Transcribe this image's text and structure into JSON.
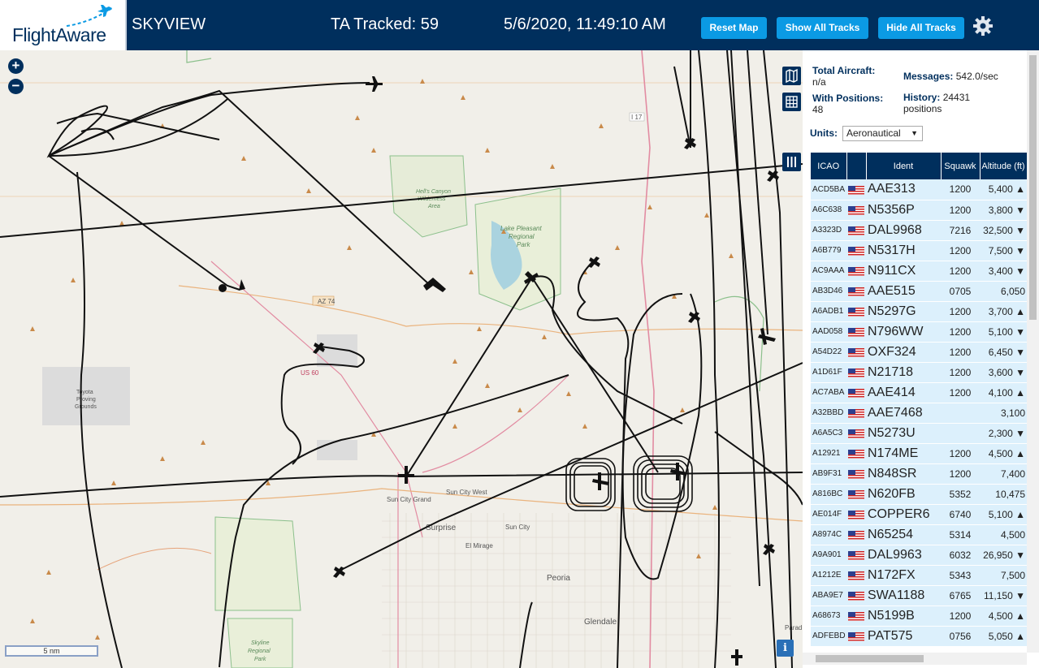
{
  "header": {
    "logo": "FlightAware",
    "title": "SKYVIEW",
    "tracked": "TA Tracked: 59",
    "clock": "5/6/2020, 11:49:10 AM",
    "buttons": {
      "reset": "Reset Map",
      "show": "Show All Tracks",
      "hide": "Hide All Tracks"
    }
  },
  "map": {
    "zoom_in": "+",
    "zoom_out": "−",
    "scale": "5 nm",
    "info": "i",
    "labels": {
      "az74": "AZ 74",
      "lake": "Lake Pleasant",
      "lake2": "Regional",
      "lake3": "Park",
      "hells1": "Hell's Canyon",
      "hells2": "Wilderness",
      "hells3": "Area",
      "toyota1": "Toyota",
      "toyota2": "Proving",
      "toyota3": "Grounds",
      "suncitygrand": "Sun City Grand",
      "suncitywest": "Sun City West",
      "surprise": "Surprise",
      "elmirage": "El Mirage",
      "suncity": "Sun City",
      "peoria": "Peoria",
      "glendale": "Glendale",
      "skyline1": "Skyline",
      "skyline2": "Regional",
      "skyline3": "Park",
      "i17": "I 17",
      "us60": "US 60",
      "parad": "Parad"
    }
  },
  "stats": {
    "total_label": "Total Aircraft:",
    "total_value": "n/a",
    "positions_label": "With Positions:",
    "positions_value": "48",
    "messages_label": "Messages:",
    "messages_value": "542.0/sec",
    "history_label": "History:",
    "history_value": "24431",
    "history_unit": "positions"
  },
  "units": {
    "label": "Units:",
    "selected": "Aeronautical"
  },
  "table": {
    "headers": [
      "ICAO",
      "",
      "Ident",
      "Squawk",
      "Altitude (ft)"
    ],
    "rows": [
      {
        "icao": "ACD5BA",
        "ident": "AAE313",
        "squawk": "1200",
        "alt": "5,400 ▲"
      },
      {
        "icao": "A6C638",
        "ident": "N5356P",
        "squawk": "1200",
        "alt": "3,800 ▼"
      },
      {
        "icao": "A3323D",
        "ident": "DAL9968",
        "squawk": "7216",
        "alt": "32,500 ▼"
      },
      {
        "icao": "A6B779",
        "ident": "N5317H",
        "squawk": "1200",
        "alt": "7,500 ▼"
      },
      {
        "icao": "AC9AAA",
        "ident": "N911CX",
        "squawk": "1200",
        "alt": "3,400 ▼"
      },
      {
        "icao": "AB3D46",
        "ident": "AAE515",
        "squawk": "0705",
        "alt": "6,050"
      },
      {
        "icao": "A6ADB1",
        "ident": "N5297G",
        "squawk": "1200",
        "alt": "3,700 ▲"
      },
      {
        "icao": "AAD058",
        "ident": "N796WW",
        "squawk": "1200",
        "alt": "5,100 ▼"
      },
      {
        "icao": "A54D22",
        "ident": "OXF324",
        "squawk": "1200",
        "alt": "6,450 ▼"
      },
      {
        "icao": "A1D61F",
        "ident": "N21718",
        "squawk": "1200",
        "alt": "3,600 ▼"
      },
      {
        "icao": "AC7ABA",
        "ident": "AAE414",
        "squawk": "1200",
        "alt": "4,100 ▲"
      },
      {
        "icao": "A32BBD",
        "ident": "AAE7468",
        "squawk": "",
        "alt": "3,100"
      },
      {
        "icao": "A6A5C3",
        "ident": "N5273U",
        "squawk": "",
        "alt": "2,300 ▼"
      },
      {
        "icao": "A12921",
        "ident": "N174ME",
        "squawk": "1200",
        "alt": "4,500 ▲"
      },
      {
        "icao": "AB9F31",
        "ident": "N848SR",
        "squawk": "1200",
        "alt": "7,400"
      },
      {
        "icao": "A816BC",
        "ident": "N620FB",
        "squawk": "5352",
        "alt": "10,475"
      },
      {
        "icao": "AE014F",
        "ident": "COPPER6",
        "squawk": "6740",
        "alt": "5,100 ▲"
      },
      {
        "icao": "A8974C",
        "ident": "N65254",
        "squawk": "5314",
        "alt": "4,500"
      },
      {
        "icao": "A9A901",
        "ident": "DAL9963",
        "squawk": "6032",
        "alt": "26,950 ▼"
      },
      {
        "icao": "A1212E",
        "ident": "N172FX",
        "squawk": "5343",
        "alt": "7,500"
      },
      {
        "icao": "ABA9E7",
        "ident": "SWA1188",
        "squawk": "6765",
        "alt": "11,150 ▼"
      },
      {
        "icao": "A68673",
        "ident": "N5199B",
        "squawk": "1200",
        "alt": "4,500 ▲"
      },
      {
        "icao": "ADFEBD",
        "ident": "PAT575",
        "squawk": "0756",
        "alt": "5,050 ▲"
      }
    ]
  },
  "colors": {
    "header_bg": "#002f5d",
    "button": "#0b9ae4",
    "row_bg": "#dcf0fc",
    "road_pink": "#e28ca2",
    "road_orange": "#eab37d"
  }
}
